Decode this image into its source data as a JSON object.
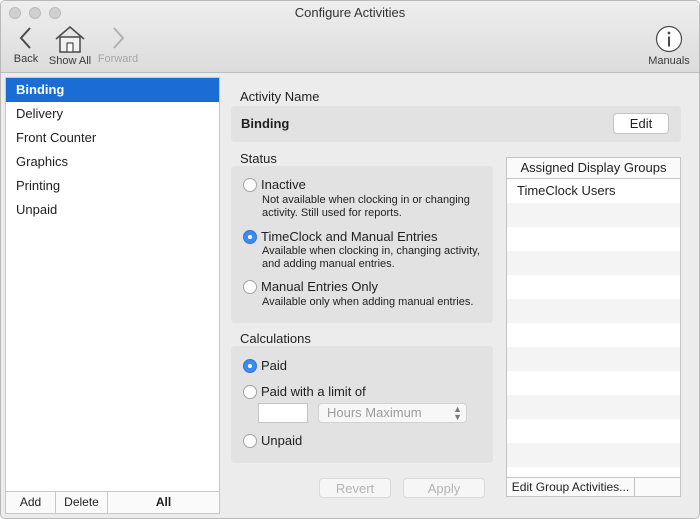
{
  "window": {
    "title": "Configure Activities"
  },
  "toolbar": {
    "back_label": "Back",
    "show_all_label": "Show All",
    "forward_label": "Forward",
    "manuals_label": "Manuals"
  },
  "sidebar": {
    "items": [
      {
        "label": "Binding"
      },
      {
        "label": "Delivery"
      },
      {
        "label": "Front Counter"
      },
      {
        "label": "Graphics"
      },
      {
        "label": "Printing"
      },
      {
        "label": "Unpaid"
      }
    ],
    "selected": "Binding",
    "add_label": "Add",
    "delete_label": "Delete",
    "all_label": "All"
  },
  "activity": {
    "section_label": "Activity Name",
    "name": "Binding",
    "edit_label": "Edit"
  },
  "status": {
    "section_label": "Status",
    "options": [
      {
        "label": "Inactive",
        "description": "Not available when clocking in or changing activity. Still used for reports.",
        "selected": false
      },
      {
        "label": "TimeClock and Manual Entries",
        "description": "Available when clocking in, changing activity, and adding manual entries.",
        "selected": true
      },
      {
        "label": "Manual Entries Only",
        "description": "Available only when adding manual entries.",
        "selected": false
      }
    ]
  },
  "calculations": {
    "section_label": "Calculations",
    "paid_label": "Paid",
    "paid_limit_label": "Paid with a limit of",
    "limit_value": "",
    "limit_unit": "Hours Maximum",
    "unpaid_label": "Unpaid",
    "selected": "Paid"
  },
  "actions": {
    "revert_label": "Revert",
    "apply_label": "Apply"
  },
  "display_groups": {
    "header": "Assigned Display Groups",
    "rows": [
      "TimeClock Users"
    ],
    "edit_label": "Edit Group Activities..."
  },
  "colors": {
    "accent": "#1b6dd6",
    "radio_on": "#3b8bf0"
  }
}
